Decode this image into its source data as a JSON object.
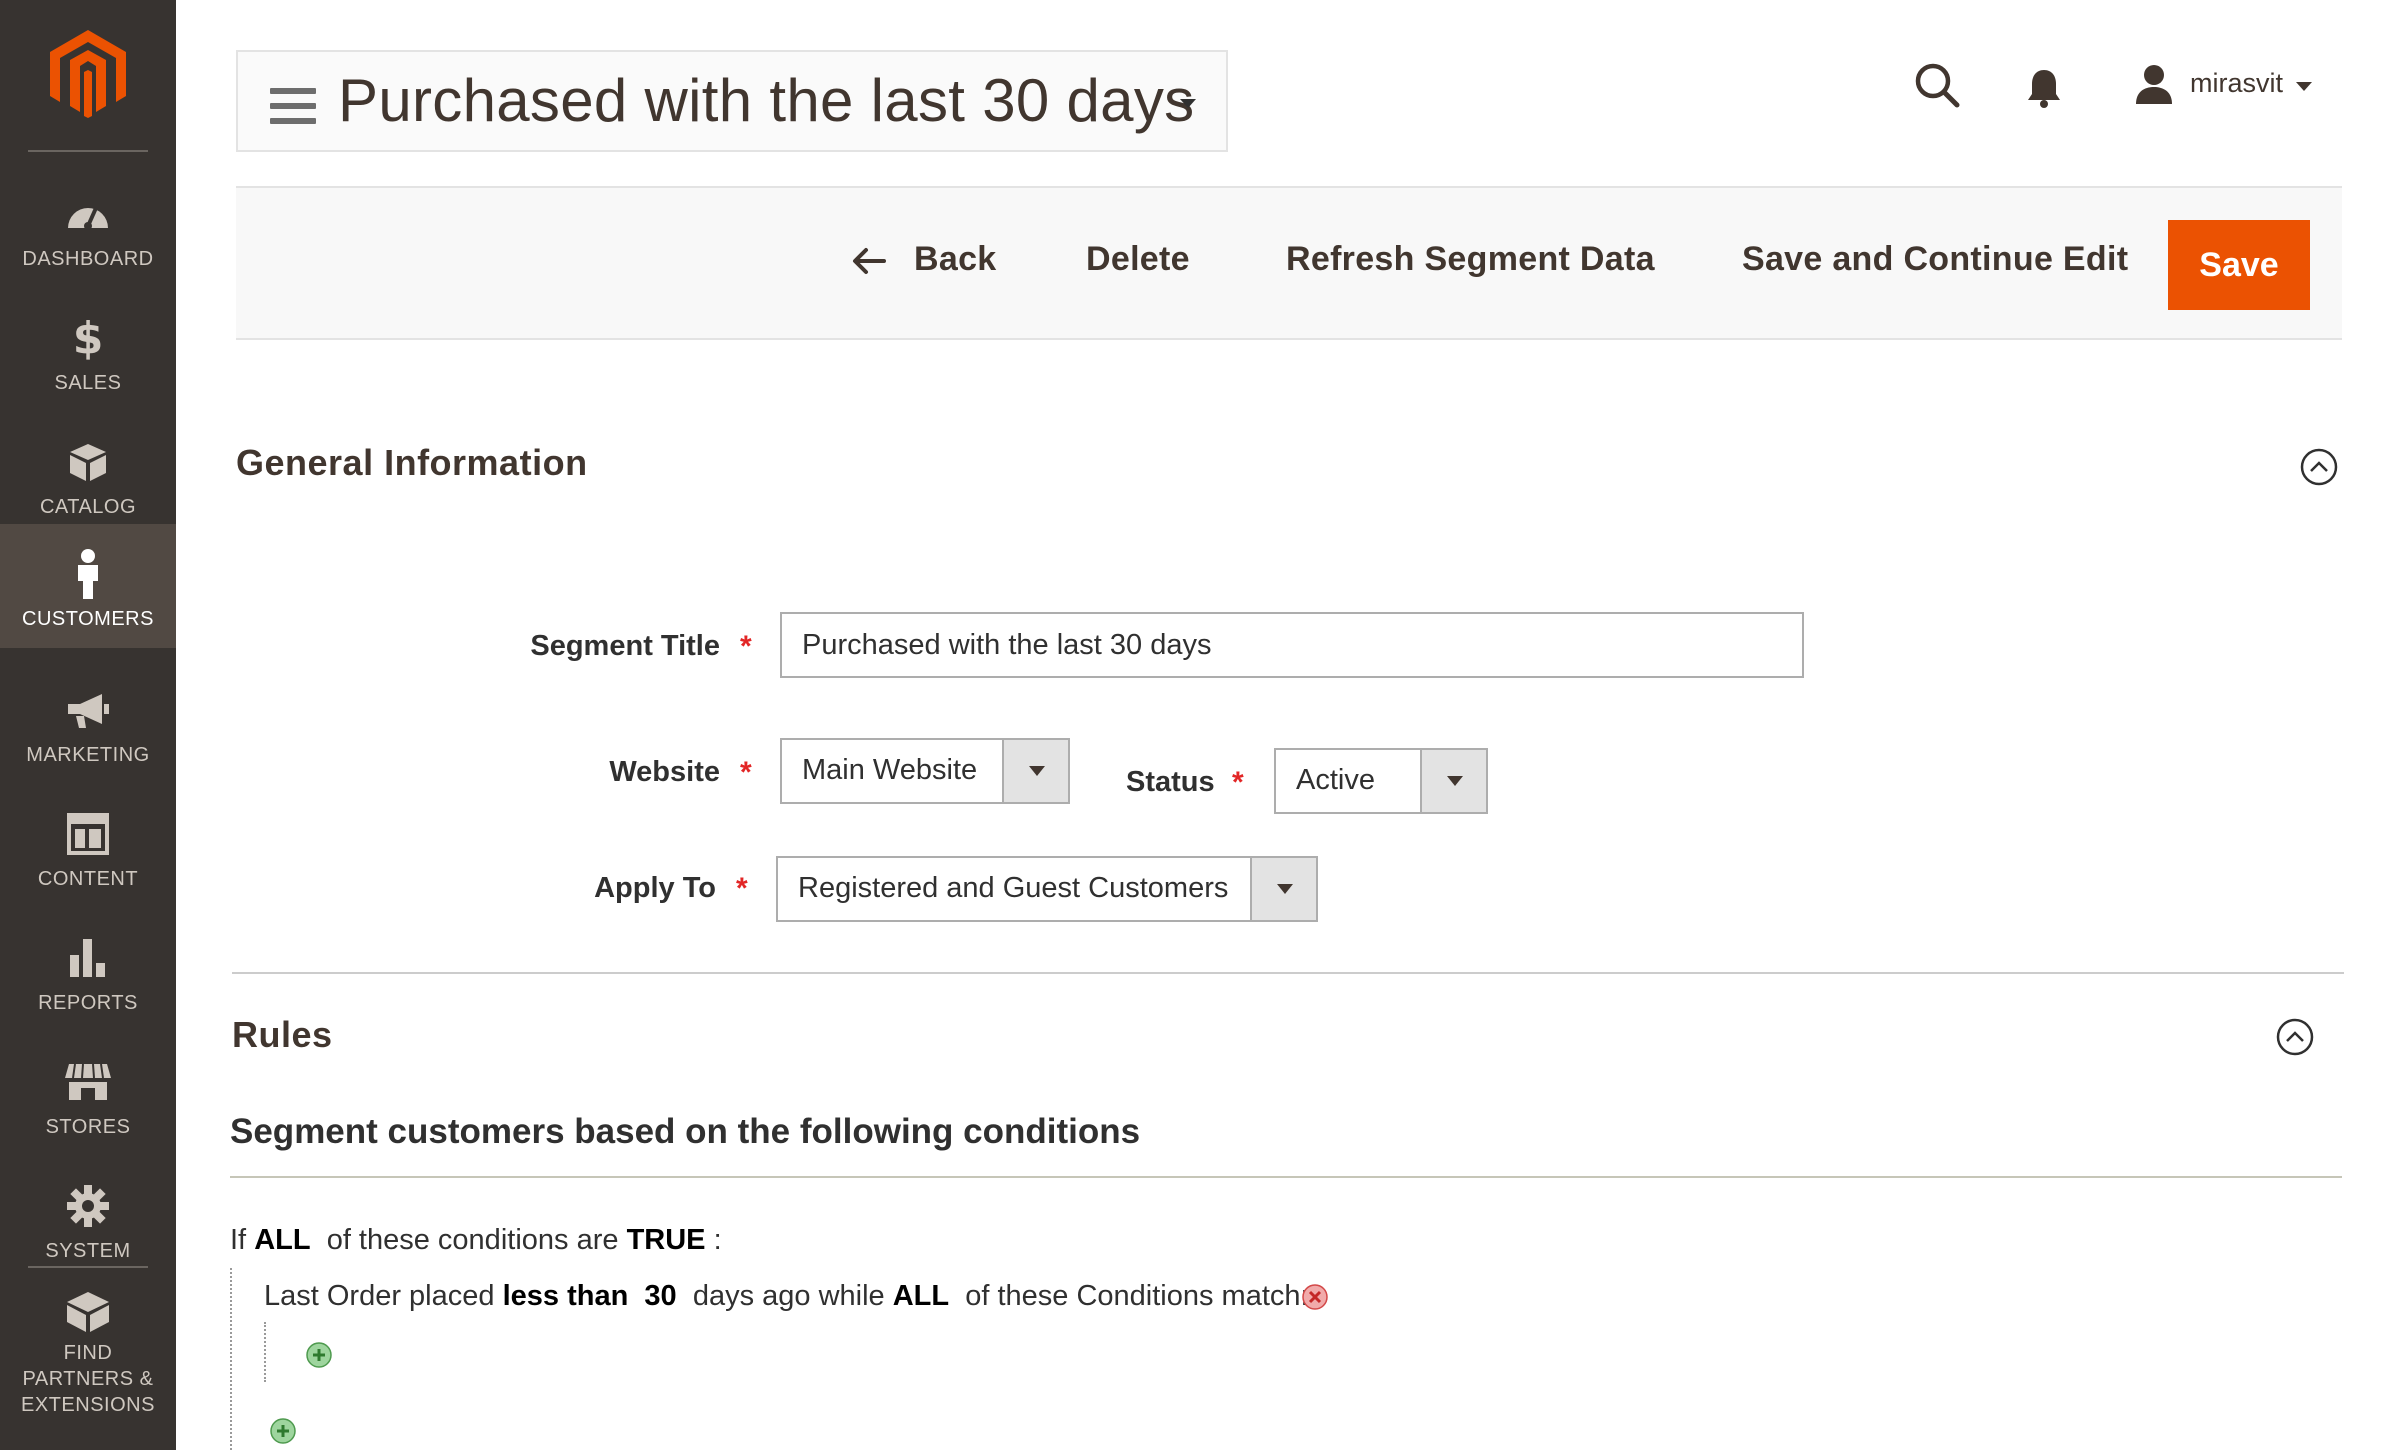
{
  "sidebar": {
    "items": [
      {
        "label": "DASHBOARD",
        "icon": "dashboard-icon"
      },
      {
        "label": "SALES",
        "icon": "dollar-icon"
      },
      {
        "label": "CATALOG",
        "icon": "box-icon"
      },
      {
        "label": "CUSTOMERS",
        "icon": "person-icon",
        "active": true
      },
      {
        "label": "MARKETING",
        "icon": "megaphone-icon"
      },
      {
        "label": "CONTENT",
        "icon": "layout-icon"
      },
      {
        "label": "REPORTS",
        "icon": "bar-chart-icon"
      },
      {
        "label": "STORES",
        "icon": "storefront-icon"
      },
      {
        "label": "SYSTEM",
        "icon": "gear-icon"
      },
      {
        "label": "FIND PARTNERS & EXTENSIONS",
        "icon": "blocks-icon"
      }
    ]
  },
  "header": {
    "title": "Purchased with the last 30 days",
    "user": "mirasvit"
  },
  "toolbar": {
    "back": "Back",
    "delete": "Delete",
    "refresh": "Refresh Segment Data",
    "save_continue": "Save and Continue Edit",
    "save": "Save"
  },
  "general": {
    "title": "General Information",
    "segment_title_label": "Segment Title",
    "segment_title_value": "Purchased with the last 30 days",
    "website_label": "Website",
    "website_value": "Main Website",
    "status_label": "Status",
    "status_value": "Active",
    "apply_label": "Apply To",
    "apply_value": "Registered and Guest Customers",
    "required_mark": "*"
  },
  "rules": {
    "title": "Rules",
    "subtitle": "Segment customers based on the following conditions",
    "line1": {
      "if": "If",
      "all": "ALL",
      "mid": "of these conditions are",
      "true": "TRUE",
      "end": ":"
    },
    "line2": {
      "a": "Last Order placed",
      "op": "less than",
      "num": "30",
      "b": "days ago while",
      "all": "ALL",
      "c": "of these Conditions match:"
    }
  },
  "colors": {
    "sidebar_bg": "#373330",
    "sidebar_active": "#514943",
    "brand_orange": "#eb5202",
    "required_red": "#e22626"
  }
}
